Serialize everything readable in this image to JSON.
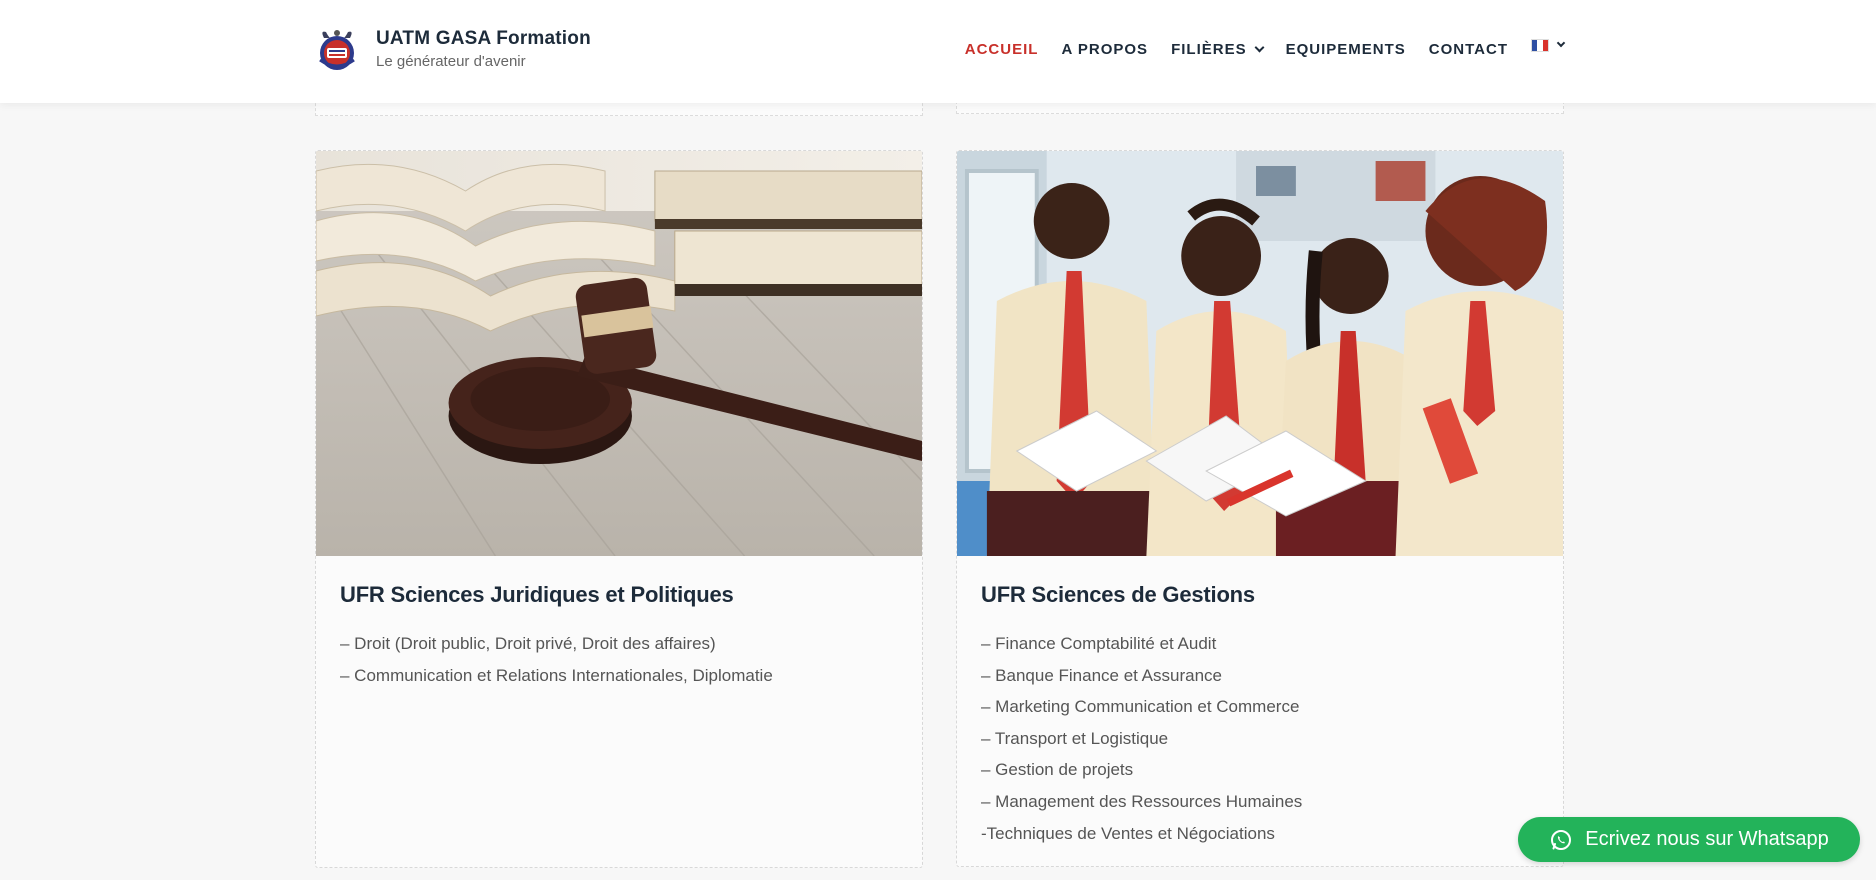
{
  "header": {
    "site_title": "UATM GASA Formation",
    "tagline": "Le générateur d'avenir",
    "nav": [
      {
        "label": "ACCUEIL",
        "active": true
      },
      {
        "label": "A PROPOS"
      },
      {
        "label": "FILIÈRES",
        "dropdown": true
      },
      {
        "label": "EQUIPEMENTS"
      },
      {
        "label": "CONTACT"
      }
    ],
    "language": {
      "icon": "french-flag-icon"
    },
    "colors": {
      "active_nav": "#c8302a",
      "nav": "#1d2b3a"
    }
  },
  "cards": [
    {
      "title": "UFR Sciences Juridiques et Politiques",
      "image": "gavel-and-law-books",
      "items": [
        "– Droit (Droit public, Droit privé, Droit des affaires)",
        "– Communication et Relations Internationales, Diplomatie"
      ]
    },
    {
      "title": "UFR Sciences de Gestions",
      "image": "students-reading-books",
      "items": [
        "– Finance Comptabilité et Audit",
        "– Banque Finance et Assurance",
        "– Marketing Communication et Commerce",
        "– Transport et Logistique",
        "– Gestion de projets",
        "– Management des Ressources Humaines",
        "-Techniques de Ventes et Négociations"
      ]
    }
  ],
  "whatsapp": {
    "label": "Ecrivez nous sur Whatsapp",
    "color": "#23b35a",
    "icon": "whatsapp-icon"
  }
}
